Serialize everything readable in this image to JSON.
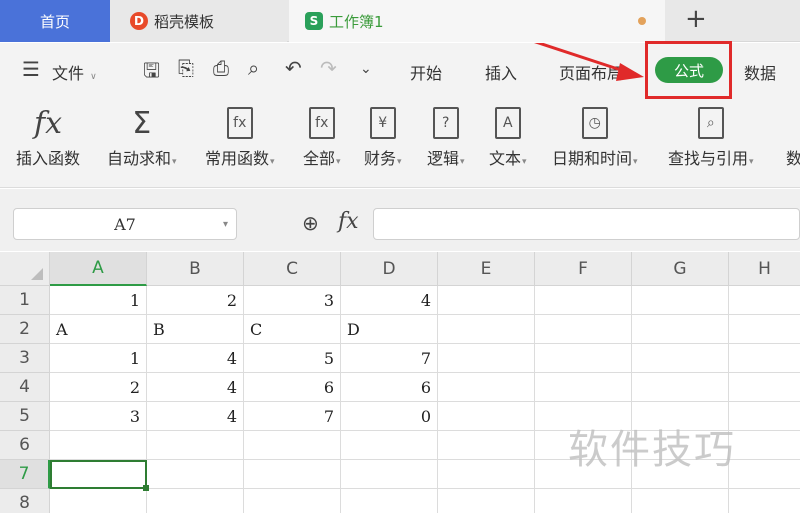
{
  "tabs": {
    "home": "首页",
    "daoke": "稻壳模板",
    "daoke_logo": "D",
    "workbook": "工作簿1",
    "workbook_logo": "S",
    "new_tab": "+"
  },
  "menu": {
    "file": "文件",
    "items": [
      "开始",
      "插入",
      "页面布局",
      "公式",
      "数据"
    ],
    "active": "公式"
  },
  "tools": [
    {
      "label": "插入函数",
      "icon": "fx"
    },
    {
      "label": "自动求和",
      "icon": "Σ"
    },
    {
      "label": "常用函数",
      "icon": "fx"
    },
    {
      "label": "全部",
      "icon": "fx"
    },
    {
      "label": "财务",
      "icon": "¥"
    },
    {
      "label": "逻辑",
      "icon": "?"
    },
    {
      "label": "文本",
      "icon": "A"
    },
    {
      "label": "日期和时间",
      "icon": "◷"
    },
    {
      "label": "查找与引用",
      "icon": "⌕"
    },
    {
      "label": "数",
      "icon": ""
    }
  ],
  "formula_bar": {
    "name_box": "A7",
    "fx_symbol": "fx",
    "value": ""
  },
  "columns": [
    "A",
    "B",
    "C",
    "D",
    "E",
    "F",
    "G",
    "H"
  ],
  "rows": [
    "1",
    "2",
    "3",
    "4",
    "5",
    "6",
    "7",
    "8"
  ],
  "cells": [
    [
      "1",
      "2",
      "3",
      "4"
    ],
    [
      "A",
      "B",
      "C",
      "D"
    ],
    [
      "1",
      "4",
      "5",
      "7"
    ],
    [
      "2",
      "4",
      "6",
      "6"
    ],
    [
      "3",
      "4",
      "7",
      "0"
    ]
  ],
  "selected_cell": "A7",
  "watermark": "软件技巧",
  "colors": {
    "accent": "#2e9b46",
    "highlight": "#e02a2a",
    "home_tab": "#4a72d9"
  }
}
